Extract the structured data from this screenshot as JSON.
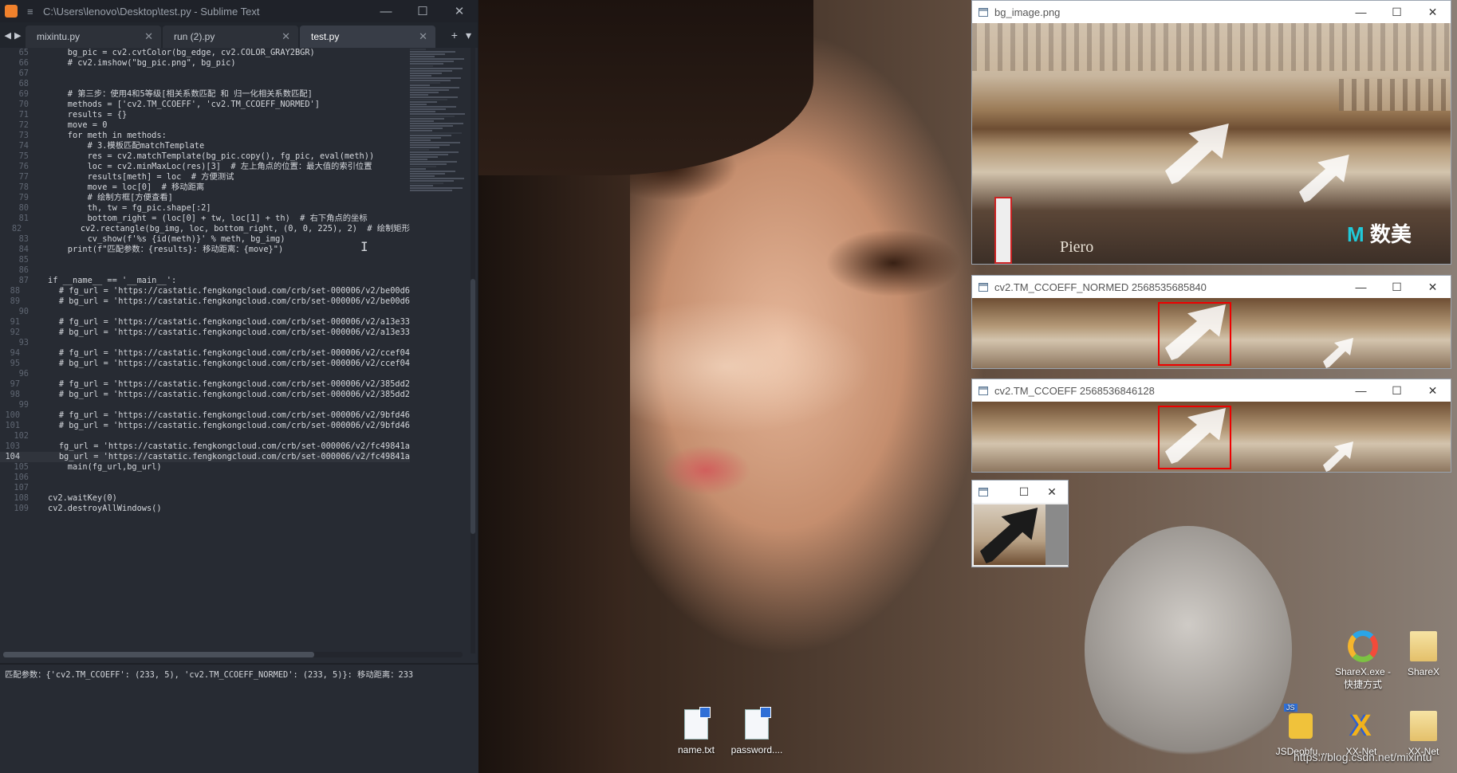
{
  "editor": {
    "title": "C:\\Users\\lenovo\\Desktop\\test.py - Sublime Text",
    "tabs": [
      {
        "label": "mixintu.py"
      },
      {
        "label": "run (2).py"
      },
      {
        "label": "test.py"
      }
    ],
    "lines": [
      {
        "n": "65",
        "t": "    bg_pic = cv2.cvtColor(bg_edge, cv2.COLOR_GRAY2BGR)"
      },
      {
        "n": "66",
        "t": "    # cv2.imshow(\"bg_pic.png\", bg_pic)"
      },
      {
        "n": "67",
        "t": ""
      },
      {
        "n": "68",
        "t": ""
      },
      {
        "n": "69",
        "t": "    # 第三步：使用4和5等级[相关系数匹配 和 归一化相关系数匹配]"
      },
      {
        "n": "70",
        "t": "    methods = ['cv2.TM_CCOEFF', 'cv2.TM_CCOEFF_NORMED']"
      },
      {
        "n": "71",
        "t": "    results = {}"
      },
      {
        "n": "72",
        "t": "    move = 0"
      },
      {
        "n": "73",
        "t": "    for meth in methods:"
      },
      {
        "n": "74",
        "t": "        # 3.模板匹配matchTemplate"
      },
      {
        "n": "75",
        "t": "        res = cv2.matchTemplate(bg_pic.copy(), fg_pic, eval(meth))"
      },
      {
        "n": "76",
        "t": "        loc = cv2.minMaxLoc(res)[3]  # 左上角点的位置：最大值的索引位置"
      },
      {
        "n": "77",
        "t": "        results[meth] = loc  # 方便测试"
      },
      {
        "n": "78",
        "t": "        move = loc[0]  # 移动距离"
      },
      {
        "n": "79",
        "t": "        # 绘制方框[方便查看]"
      },
      {
        "n": "80",
        "t": "        th, tw = fg_pic.shape[:2]"
      },
      {
        "n": "81",
        "t": "        bottom_right = (loc[0] + tw, loc[1] + th)  # 右下角点的坐标"
      },
      {
        "n": "82",
        "t": "        cv2.rectangle(bg_img, loc, bottom_right, (0, 0, 225), 2)  # 绘制矩形"
      },
      {
        "n": "83",
        "t": "        cv_show(f'%s {id(meth)}' % meth, bg_img)"
      },
      {
        "n": "84",
        "t": "    print(f\"匹配参数：{results}: 移动距离：{move}\")"
      },
      {
        "n": "85",
        "t": ""
      },
      {
        "n": "86",
        "t": ""
      },
      {
        "n": "87",
        "t": "if __name__ == '__main__':"
      },
      {
        "n": "88",
        "t": "    # fg_url = 'https://castatic.fengkongcloud.com/crb/set-000006/v2/be00d6"
      },
      {
        "n": "89",
        "t": "    # bg_url = 'https://castatic.fengkongcloud.com/crb/set-000006/v2/be00d6"
      },
      {
        "n": "90",
        "t": ""
      },
      {
        "n": "91",
        "t": "    # fg_url = 'https://castatic.fengkongcloud.com/crb/set-000006/v2/a13e33"
      },
      {
        "n": "92",
        "t": "    # bg_url = 'https://castatic.fengkongcloud.com/crb/set-000006/v2/a13e33"
      },
      {
        "n": "93",
        "t": ""
      },
      {
        "n": "94",
        "t": "    # fg_url = 'https://castatic.fengkongcloud.com/crb/set-000006/v2/ccef04"
      },
      {
        "n": "95",
        "t": "    # bg_url = 'https://castatic.fengkongcloud.com/crb/set-000006/v2/ccef04"
      },
      {
        "n": "96",
        "t": ""
      },
      {
        "n": "97",
        "t": "    # fg_url = 'https://castatic.fengkongcloud.com/crb/set-000006/v2/385dd2"
      },
      {
        "n": "98",
        "t": "    # bg_url = 'https://castatic.fengkongcloud.com/crb/set-000006/v2/385dd2"
      },
      {
        "n": "99",
        "t": ""
      },
      {
        "n": "100",
        "t": "    # fg_url = 'https://castatic.fengkongcloud.com/crb/set-000006/v2/9bfd46"
      },
      {
        "n": "101",
        "t": "    # bg_url = 'https://castatic.fengkongcloud.com/crb/set-000006/v2/9bfd46"
      },
      {
        "n": "102",
        "t": ""
      },
      {
        "n": "103",
        "t": "    fg_url = 'https://castatic.fengkongcloud.com/crb/set-000006/v2/fc49841a"
      },
      {
        "n": "104",
        "t": "    bg_url = 'https://castatic.fengkongcloud.com/crb/set-000006/v2/fc49841a"
      },
      {
        "n": "105",
        "t": "    main(fg_url,bg_url)"
      },
      {
        "n": "106",
        "t": ""
      },
      {
        "n": "107",
        "t": ""
      },
      {
        "n": "108",
        "t": "cv2.waitKey(0)"
      },
      {
        "n": "109",
        "t": "cv2.destroyAllWindows()"
      }
    ],
    "current_line": "104",
    "console": "匹配参数：{'cv2.TM_CCOEFF': (233, 5), 'cv2.TM_CCOEFF_NORMED': (233, 5)}: 移动距离：233"
  },
  "windows": {
    "bg_image": {
      "title": "bg_image.png"
    },
    "normed": {
      "title": "cv2.TM_CCOEFF_NORMED 2568535685840"
    },
    "ccoeff": {
      "title": "cv2.TM_CCOEFF 2568536846128"
    },
    "fg": {
      "title": ""
    }
  },
  "image_text": {
    "shop_sign": "Piero",
    "logo_text": "数美"
  },
  "desktop_icons": [
    {
      "label": "name.txt",
      "icon": "text-file-icon"
    },
    {
      "label": "password....",
      "icon": "text-file-icon"
    },
    {
      "label": "ShareX.exe - 快捷方式",
      "icon": "sharex-icon"
    },
    {
      "label": "ShareX",
      "icon": "folder-icon"
    },
    {
      "label": "JSDeobfu...",
      "icon": "js-lock-icon"
    },
    {
      "label": "XX-Net",
      "icon": "xxnet-icon"
    },
    {
      "label": "XX-Net",
      "icon": "folder-icon"
    }
  ],
  "watermark": "https://blog.csdn.net/mixintu"
}
